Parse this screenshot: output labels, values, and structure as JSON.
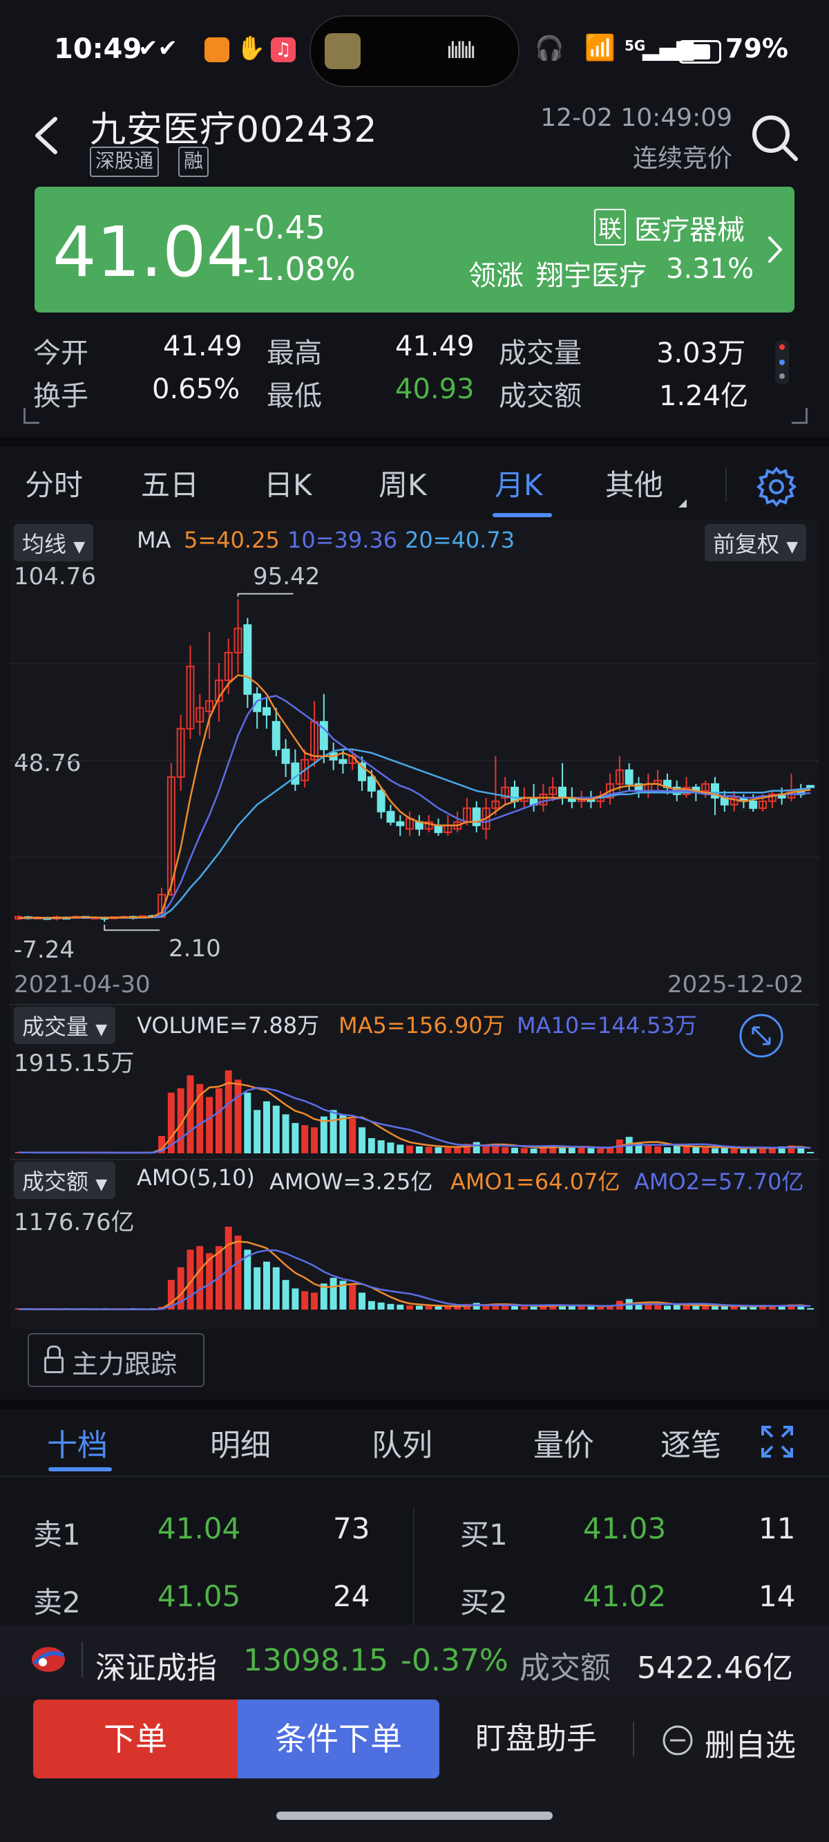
{
  "status_bar": {
    "time": "10:49",
    "battery": "79%",
    "network": "5G"
  },
  "header": {
    "stock_name": "九安医疗",
    "stock_code": "002432",
    "tags": [
      "深股通",
      "融"
    ],
    "datetime": "12-02 10:49:09",
    "trade_status": "连续竞价"
  },
  "price_card": {
    "price": "41.04",
    "change": "-0.45",
    "change_pct": "-1.08%",
    "sector_badge": "联",
    "sector": "医疗器械",
    "leader_label": "领涨",
    "leader_name": "翔宇医疗",
    "leader_pct": "3.31%"
  },
  "stats": [
    {
      "label": "今开",
      "value": "41.49",
      "color": "white"
    },
    {
      "label": "最高",
      "value": "41.49",
      "color": "white"
    },
    {
      "label": "成交量",
      "value": "3.03万",
      "color": "white"
    },
    {
      "label": "换手",
      "value": "0.65%",
      "color": "white"
    },
    {
      "label": "最低",
      "value": "40.93",
      "color": "green"
    },
    {
      "label": "成交额",
      "value": "1.24亿",
      "color": "white"
    }
  ],
  "tabs": [
    "分时",
    "五日",
    "日K",
    "周K",
    "月K",
    "其他"
  ],
  "active_tab": "月K",
  "chart_header": {
    "ma_dropdown": "均线",
    "ma_label": "MA",
    "ma5": "5=40.25",
    "ma10": "10=39.36",
    "ma20": "20=40.73",
    "adjust_dropdown": "前复权",
    "y_top": "104.76",
    "y_mid": "48.76",
    "y_bottom": "-7.24",
    "high_label": "95.42",
    "low_label": "2.10",
    "date_start": "2021-04-30",
    "date_end": "2025-12-02"
  },
  "volume_header": {
    "dropdown": "成交量",
    "volume": "VOLUME=7.88万",
    "ma5": "MA5=156.90万",
    "ma10": "MA10=144.53万",
    "y_top": "1915.15万"
  },
  "amount_header": {
    "dropdown": "成交额",
    "amo": "AMO(5,10)",
    "amow": "AMOW=3.25亿",
    "amo1": "AMO1=64.07亿",
    "amo2": "AMO2=57.70亿",
    "y_top": "1176.76亿"
  },
  "main_force": "主力跟踪",
  "orderbook_tabs": [
    "十档",
    "明细",
    "队列",
    "量价",
    "逐笔"
  ],
  "orderbook": {
    "sell": [
      {
        "label": "卖1",
        "price": "41.04",
        "qty": "73"
      },
      {
        "label": "卖2",
        "price": "41.05",
        "qty": "24"
      }
    ],
    "buy": [
      {
        "label": "买1",
        "price": "41.03",
        "qty": "11"
      },
      {
        "label": "买2",
        "price": "41.02",
        "qty": "14"
      }
    ]
  },
  "index_bar": {
    "name": "深证成指",
    "value": "13098.15",
    "change": "-0.37%",
    "amount_label": "成交额",
    "amount": "5422.46亿"
  },
  "bottom_bar": {
    "order": "下单",
    "cond_order": "条件下单",
    "assistant": "盯盘助手",
    "remove": "删自选"
  },
  "chart_data": {
    "type": "candlestick",
    "title": "",
    "ylim": [
      -7.24,
      104.76
    ],
    "x_range": [
      "2021-04-30",
      "2025-12-02"
    ],
    "annotations": [
      {
        "label": "95.42",
        "kind": "high"
      },
      {
        "label": "2.10",
        "kind": "low"
      }
    ],
    "candles": [
      {
        "o": 3.0,
        "c": 3.6,
        "h": 4.0,
        "l": 2.6
      },
      {
        "o": 3.5,
        "c": 3.1,
        "h": 3.8,
        "l": 2.8
      },
      {
        "o": 3.2,
        "c": 3.4,
        "h": 3.7,
        "l": 2.9
      },
      {
        "o": 3.3,
        "c": 3.0,
        "h": 3.6,
        "l": 2.7
      },
      {
        "o": 3.0,
        "c": 3.5,
        "h": 3.9,
        "l": 2.5
      },
      {
        "o": 3.4,
        "c": 3.2,
        "h": 3.7,
        "l": 2.9
      },
      {
        "o": 3.2,
        "c": 3.6,
        "h": 3.9,
        "l": 3.0
      },
      {
        "o": 3.6,
        "c": 3.3,
        "h": 3.8,
        "l": 3.0
      },
      {
        "o": 3.3,
        "c": 3.4,
        "h": 3.7,
        "l": 3.0
      },
      {
        "o": 3.4,
        "c": 3.1,
        "h": 3.6,
        "l": 2.1
      },
      {
        "o": 3.1,
        "c": 3.5,
        "h": 3.8,
        "l": 2.9
      },
      {
        "o": 3.4,
        "c": 3.6,
        "h": 3.9,
        "l": 3.1
      },
      {
        "o": 3.6,
        "c": 3.3,
        "h": 3.9,
        "l": 2.8
      },
      {
        "o": 3.3,
        "c": 3.8,
        "h": 4.0,
        "l": 3.0
      },
      {
        "o": 3.8,
        "c": 3.5,
        "h": 4.2,
        "l": 3.2
      },
      {
        "o": 3.5,
        "c": 10.0,
        "h": 12.0,
        "l": 3.3
      },
      {
        "o": 10.0,
        "c": 44.0,
        "h": 48.0,
        "l": 9.5
      },
      {
        "o": 44.0,
        "c": 58.0,
        "h": 62.0,
        "l": 40.0
      },
      {
        "o": 58.0,
        "c": 76.0,
        "h": 82.0,
        "l": 55.0
      },
      {
        "o": 60.0,
        "c": 64.0,
        "h": 68.0,
        "l": 56.0
      },
      {
        "o": 63.0,
        "c": 66.0,
        "h": 86.0,
        "l": 55.0
      },
      {
        "o": 66.0,
        "c": 72.0,
        "h": 77.0,
        "l": 60.0
      },
      {
        "o": 72.0,
        "c": 80.0,
        "h": 84.0,
        "l": 68.0
      },
      {
        "o": 80.0,
        "c": 87.0,
        "h": 95.42,
        "l": 74.0
      },
      {
        "o": 88.0,
        "c": 68.0,
        "h": 90.0,
        "l": 64.0
      },
      {
        "o": 68.0,
        "c": 63.0,
        "h": 70.0,
        "l": 58.0
      },
      {
        "o": 64.0,
        "c": 62.0,
        "h": 67.0,
        "l": 58.0
      },
      {
        "o": 60.0,
        "c": 52.0,
        "h": 64.0,
        "l": 50.0
      },
      {
        "o": 52.0,
        "c": 48.0,
        "h": 55.0,
        "l": 44.0
      },
      {
        "o": 48.0,
        "c": 42.0,
        "h": 52.0,
        "l": 40.0
      },
      {
        "o": 43.0,
        "c": 49.0,
        "h": 52.0,
        "l": 41.0
      },
      {
        "o": 49.0,
        "c": 60.0,
        "h": 66.0,
        "l": 47.0
      },
      {
        "o": 60.0,
        "c": 52.0,
        "h": 68.0,
        "l": 48.0
      },
      {
        "o": 51.0,
        "c": 49.0,
        "h": 54.0,
        "l": 46.0
      },
      {
        "o": 49.0,
        "c": 48.0,
        "h": 52.0,
        "l": 45.0
      },
      {
        "o": 48.0,
        "c": 50.0,
        "h": 52.0,
        "l": 46.0
      },
      {
        "o": 48.0,
        "c": 43.0,
        "h": 50.0,
        "l": 40.0
      },
      {
        "o": 44.0,
        "c": 40.0,
        "h": 46.0,
        "l": 38.0
      },
      {
        "o": 40.0,
        "c": 34.0,
        "h": 41.0,
        "l": 32.0
      },
      {
        "o": 34.0,
        "c": 31.0,
        "h": 36.0,
        "l": 30.0
      },
      {
        "o": 31.0,
        "c": 30.0,
        "h": 33.0,
        "l": 27.0
      },
      {
        "o": 29.0,
        "c": 32.0,
        "h": 34.0,
        "l": 27.0
      },
      {
        "o": 31.0,
        "c": 29.0,
        "h": 33.0,
        "l": 27.0
      },
      {
        "o": 29.0,
        "c": 31.0,
        "h": 33.0,
        "l": 28.0
      },
      {
        "o": 30.0,
        "c": 28.0,
        "h": 32.0,
        "l": 27.0
      },
      {
        "o": 28.0,
        "c": 30.0,
        "h": 33.0,
        "l": 27.0
      },
      {
        "o": 29.0,
        "c": 31.0,
        "h": 34.0,
        "l": 28.0
      },
      {
        "o": 31.0,
        "c": 35.0,
        "h": 38.0,
        "l": 30.0
      },
      {
        "o": 35.0,
        "c": 30.0,
        "h": 37.0,
        "l": 28.0
      },
      {
        "o": 29.0,
        "c": 35.0,
        "h": 38.0,
        "l": 26.0
      },
      {
        "o": 35.0,
        "c": 37.0,
        "h": 50.0,
        "l": 33.0
      },
      {
        "o": 38.0,
        "c": 41.0,
        "h": 44.0,
        "l": 36.0
      },
      {
        "o": 41.0,
        "c": 37.0,
        "h": 43.0,
        "l": 35.0
      },
      {
        "o": 37.0,
        "c": 38.0,
        "h": 41.0,
        "l": 35.0
      },
      {
        "o": 38.0,
        "c": 36.0,
        "h": 42.0,
        "l": 34.0
      },
      {
        "o": 36.0,
        "c": 39.0,
        "h": 42.0,
        "l": 34.0
      },
      {
        "o": 39.0,
        "c": 41.0,
        "h": 44.0,
        "l": 37.0
      },
      {
        "o": 41.0,
        "c": 38.0,
        "h": 48.0,
        "l": 36.0
      },
      {
        "o": 38.0,
        "c": 37.0,
        "h": 41.0,
        "l": 35.0
      },
      {
        "o": 37.0,
        "c": 38.0,
        "h": 40.0,
        "l": 35.0
      },
      {
        "o": 38.0,
        "c": 37.0,
        "h": 40.0,
        "l": 35.0
      },
      {
        "o": 37.0,
        "c": 38.0,
        "h": 40.0,
        "l": 35.0
      },
      {
        "o": 38.0,
        "c": 42.0,
        "h": 45.0,
        "l": 36.0
      },
      {
        "o": 42.0,
        "c": 46.0,
        "h": 50.0,
        "l": 40.0
      },
      {
        "o": 46.0,
        "c": 42.0,
        "h": 48.0,
        "l": 40.0
      },
      {
        "o": 42.0,
        "c": 40.0,
        "h": 44.0,
        "l": 38.0
      },
      {
        "o": 40.0,
        "c": 42.0,
        "h": 45.0,
        "l": 38.0
      },
      {
        "o": 42.0,
        "c": 43.0,
        "h": 46.0,
        "l": 40.0
      },
      {
        "o": 43.0,
        "c": 41.0,
        "h": 45.0,
        "l": 39.0
      },
      {
        "o": 41.0,
        "c": 39.0,
        "h": 43.0,
        "l": 37.0
      },
      {
        "o": 39.0,
        "c": 41.0,
        "h": 44.0,
        "l": 38.0
      },
      {
        "o": 41.0,
        "c": 40.0,
        "h": 42.0,
        "l": 37.0
      },
      {
        "o": 40.0,
        "c": 42.0,
        "h": 43.0,
        "l": 38.0
      },
      {
        "o": 42.0,
        "c": 38.0,
        "h": 44.0,
        "l": 33.0
      },
      {
        "o": 38.0,
        "c": 36.0,
        "h": 40.0,
        "l": 34.0
      },
      {
        "o": 36.0,
        "c": 38.0,
        "h": 40.0,
        "l": 34.0
      },
      {
        "o": 38.0,
        "c": 37.0,
        "h": 39.0,
        "l": 35.0
      },
      {
        "o": 37.0,
        "c": 35.0,
        "h": 39.0,
        "l": 34.0
      },
      {
        "o": 35.0,
        "c": 37.0,
        "h": 39.0,
        "l": 34.0
      },
      {
        "o": 37.0,
        "c": 39.0,
        "h": 40.0,
        "l": 35.0
      },
      {
        "o": 39.0,
        "c": 38.0,
        "h": 41.0,
        "l": 36.0
      },
      {
        "o": 38.0,
        "c": 40.0,
        "h": 45.0,
        "l": 37.0
      },
      {
        "o": 40.0,
        "c": 39.0,
        "h": 42.0,
        "l": 38.0
      },
      {
        "o": 41.49,
        "c": 41.04,
        "h": 41.49,
        "l": 40.93
      }
    ],
    "ma5": [
      3.2,
      3.3,
      3.3,
      3.3,
      3.3,
      3.3,
      3.4,
      3.4,
      3.4,
      3.3,
      3.3,
      3.4,
      3.4,
      3.4,
      3.5,
      4.8,
      12.6,
      23.6,
      38.0,
      50.5,
      61.0,
      67.0,
      71.0,
      73.5,
      73.0,
      71.0,
      68.0,
      63.0,
      59.0,
      55.0,
      51.0,
      50.0,
      50.0,
      50.0,
      51.0,
      50.0,
      47.0,
      45.0,
      41.0,
      37.0,
      34.0,
      32.0,
      31.0,
      30.5,
      30.0,
      30.0,
      30.0,
      31.0,
      31.0,
      32.0,
      34.0,
      36.0,
      37.0,
      38.0,
      38.0,
      38.0,
      38.0,
      38.0,
      38.0,
      37.5,
      37.5,
      38.5,
      40.0,
      41.0,
      41.5,
      41.5,
      42.0,
      42.0,
      41.0,
      40.5,
      40.5,
      40.0,
      39.5,
      39.0,
      38.0,
      37.5,
      37.0,
      37.5,
      38.0,
      38.5,
      39.0,
      39.5,
      40.0,
      40.25
    ],
    "ma10": [
      3.2,
      3.2,
      3.3,
      3.3,
      3.3,
      3.3,
      3.3,
      3.3,
      3.3,
      3.3,
      3.3,
      3.4,
      3.4,
      3.4,
      3.4,
      4.0,
      8.0,
      13.5,
      20.5,
      27.0,
      33.0,
      40.0,
      48.0,
      56.0,
      62.0,
      66.0,
      67.0,
      67.5,
      66.0,
      64.0,
      62.0,
      60.0,
      58.0,
      55.0,
      53.0,
      51.0,
      49.0,
      47.0,
      45.0,
      43.0,
      41.5,
      40.5,
      39.0,
      37.0,
      35.0,
      33.5,
      32.0,
      31.0,
      31.0,
      31.0,
      32.0,
      33.0,
      34.0,
      35.0,
      36.0,
      37.0,
      37.5,
      38.0,
      38.0,
      38.0,
      38.0,
      38.5,
      39.0,
      39.5,
      40.0,
      40.0,
      40.0,
      40.0,
      40.0,
      40.0,
      40.0,
      39.5,
      39.0,
      39.0,
      38.5,
      38.5,
      38.0,
      38.0,
      38.5,
      38.5,
      39.0,
      39.0,
      39.2,
      39.36
    ],
    "ma20": [
      3.2,
      3.2,
      3.2,
      3.2,
      3.2,
      3.3,
      3.3,
      3.3,
      3.3,
      3.3,
      3.3,
      3.3,
      3.3,
      3.3,
      3.4,
      3.6,
      5.5,
      8.5,
      12.0,
      15.0,
      18.5,
      22.0,
      26.0,
      30.0,
      33.0,
      36.0,
      38.0,
      40.0,
      42.0,
      44.0,
      46.0,
      48.0,
      50.0,
      51.5,
      52.0,
      52.0,
      51.5,
      51.0,
      50.0,
      49.0,
      48.0,
      47.0,
      46.0,
      45.0,
      44.0,
      43.0,
      42.0,
      41.0,
      40.0,
      39.5,
      39.0,
      38.5,
      38.0,
      38.0,
      38.0,
      38.0,
      38.0,
      38.0,
      38.0,
      38.0,
      38.0,
      38.0,
      38.5,
      39.0,
      39.0,
      39.5,
      39.5,
      39.5,
      39.5,
      39.5,
      39.5,
      39.5,
      39.5,
      39.5,
      39.5,
      39.5,
      39.5,
      39.5,
      39.5,
      40.0,
      40.0,
      40.2,
      40.5,
      40.73
    ],
    "volume_wan": [
      20,
      18,
      17,
      19,
      15,
      16,
      18,
      14,
      16,
      13,
      15,
      14,
      16,
      18,
      17,
      400,
      1400,
      1500,
      1800,
      1600,
      1300,
      1500,
      1915.15,
      1700,
      1400,
      1000,
      1200,
      1100,
      900,
      700,
      650,
      600,
      850,
      1000,
      900,
      800,
      600,
      350,
      300,
      250,
      200,
      180,
      160,
      150,
      140,
      130,
      150,
      220,
      260,
      180,
      220,
      140,
      130,
      120,
      110,
      150,
      180,
      160,
      140,
      130,
      120,
      110,
      150,
      320,
      380,
      250,
      200,
      160,
      140,
      180,
      160,
      150,
      130,
      120,
      140,
      110,
      100,
      130,
      150,
      120,
      160,
      180,
      150,
      7.88
    ],
    "amount_yi": [
      6,
      5,
      5,
      5,
      4,
      4,
      5,
      4,
      4,
      3,
      4,
      4,
      4,
      5,
      4,
      40,
      420,
      600,
      850,
      900,
      800,
      900,
      1176.76,
      1050,
      850,
      600,
      680,
      600,
      420,
      300,
      260,
      240,
      370,
      450,
      410,
      350,
      240,
      120,
      100,
      80,
      70,
      60,
      55,
      50,
      45,
      40,
      50,
      80,
      95,
      65,
      85,
      55,
      50,
      45,
      42,
      58,
      75,
      62,
      55,
      50,
      45,
      42,
      60,
      125,
      150,
      100,
      80,
      65,
      55,
      72,
      65,
      60,
      52,
      48,
      56,
      45,
      40,
      52,
      60,
      48,
      64,
      72,
      60,
      1.24
    ]
  }
}
